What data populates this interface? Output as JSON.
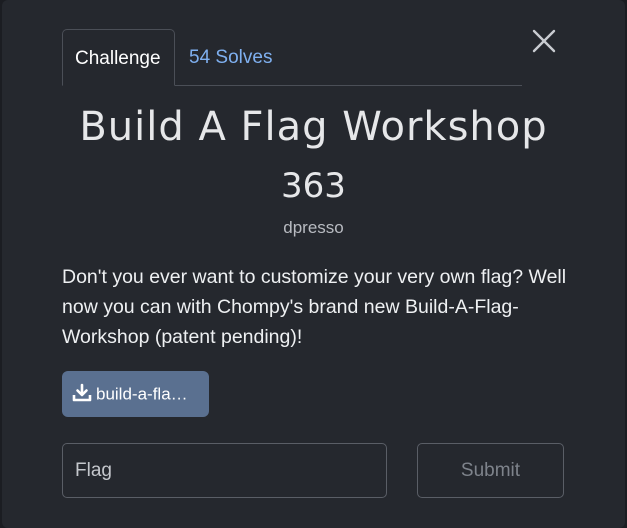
{
  "tabs": {
    "challenge": "Challenge",
    "solves": "54 Solves"
  },
  "challenge": {
    "name": "Build A Flag Workshop",
    "points": "363",
    "author": "dpresso",
    "description": "Don't you ever want to customize your very own flag? Well now you can with Chompy's brand new Build-A-Flag-Workshop (patent pending)!"
  },
  "file": {
    "label": "build-a-fla…",
    "icon": "download-icon"
  },
  "form": {
    "flag_placeholder": "Flag",
    "submit_label": "Submit"
  },
  "icons": {
    "close": "close-icon"
  },
  "colors": {
    "modal_bg": "#25282e",
    "accent_link": "#7fb0f0",
    "download_button": "#5a7090"
  }
}
